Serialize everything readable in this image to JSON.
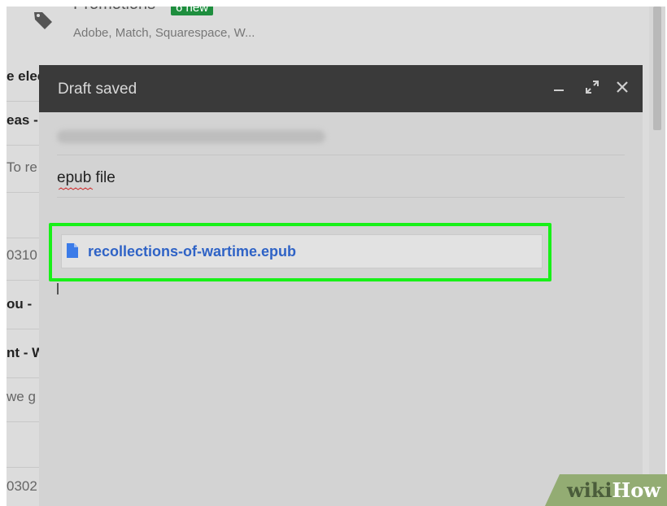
{
  "inbox": {
    "promotions": {
      "title": "Promotions",
      "badge": "6 new",
      "senders": "Adobe, Match, Squarespace, W..."
    },
    "rows": [
      {
        "text": "e elec",
        "style": "bold"
      },
      {
        "text": "eas -",
        "style": "bold"
      },
      {
        "text": "To re",
        "style": "light"
      },
      {
        "text": "",
        "style": ""
      },
      {
        "text": "0310",
        "style": "light"
      },
      {
        "text": "ou -",
        "style": "bold"
      },
      {
        "text": "nt - W",
        "style": "bold"
      },
      {
        "text": "we g",
        "style": "light"
      },
      {
        "text": "",
        "style": ""
      },
      {
        "text": "0302",
        "style": "light"
      }
    ]
  },
  "compose": {
    "title": "Draft saved",
    "minimize_icon": "minimize-icon",
    "expand_icon": "expand-icon",
    "close_icon": "close-icon",
    "recipient": "devang joshi (devang.vfl@gmail.com)",
    "subject": "epub file",
    "attachment": {
      "name": "recollections-of-wartime.epub",
      "icon": "file-icon"
    }
  },
  "watermark": {
    "part1": "wiki",
    "part2": "How"
  },
  "colors": {
    "header_bg": "#3a3a3a",
    "highlight": "#18f018",
    "link": "#2f63c6",
    "badge": "#1e8e3e"
  }
}
